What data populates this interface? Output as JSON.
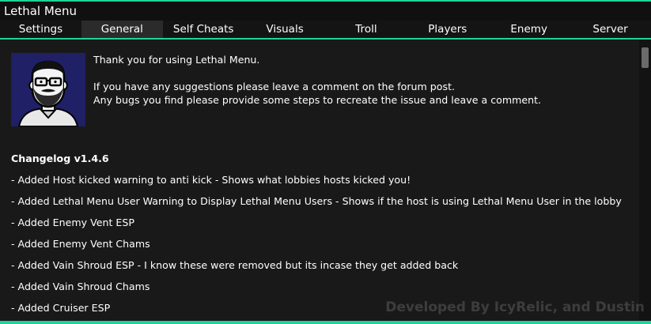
{
  "window": {
    "title": "Lethal Menu"
  },
  "tabs": [
    {
      "label": "Settings",
      "active": false
    },
    {
      "label": "General",
      "active": true
    },
    {
      "label": "Self Cheats",
      "active": false
    },
    {
      "label": "Visuals",
      "active": false
    },
    {
      "label": "Troll",
      "active": false
    },
    {
      "label": "Players",
      "active": false
    },
    {
      "label": "Enemy",
      "active": false
    },
    {
      "label": "Server",
      "active": false
    }
  ],
  "intro": {
    "line1": "Thank you for using Lethal Menu.",
    "line2": "If you have any suggestions please leave a comment on the forum post.",
    "line3": "Any bugs you find please provide some steps to recreate the issue and leave a comment."
  },
  "changelog": {
    "title": "Changelog v1.4.6",
    "items": [
      "- Added Host kicked warning to anti kick - Shows what lobbies hosts kicked you!",
      "- Added Lethal Menu User Warning to Display Lethal Menu Users - Shows if the host is using Lethal Menu User in the lobby",
      "- Added Enemy Vent ESP",
      "- Added Enemy Vent Chams",
      "- Added Vain Shroud ESP - I know these were removed but its incase they get added back",
      "- Added Vain Shroud Chams",
      "- Added Cruiser ESP"
    ]
  },
  "watermark": "Developed By IcyRelic, and Dustin",
  "colors": {
    "accent": "#1fd39a",
    "background": "#191919",
    "title_bar": "#101010",
    "active_tab": "#2b2b2b",
    "avatar_bg": "#202066"
  },
  "icons": {
    "avatar": "bearded-man-with-glasses-portrait"
  }
}
